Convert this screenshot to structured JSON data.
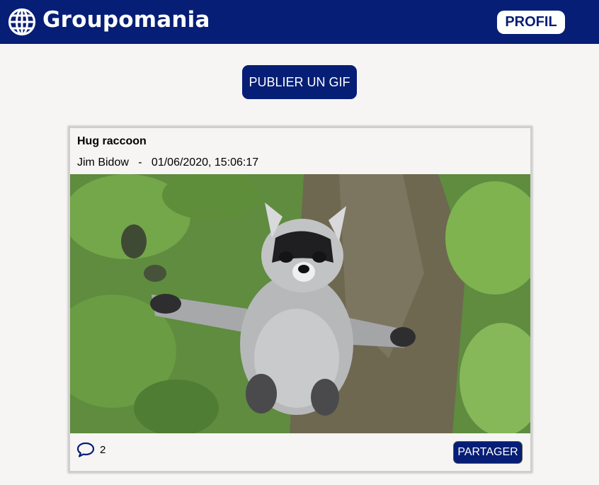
{
  "header": {
    "brand": "Groupomania",
    "logo_icon": "globe-icon",
    "profile_button": "PROFIL",
    "background": "#061e75"
  },
  "actions": {
    "publish_button": "PUBLIER UN GIF"
  },
  "post": {
    "title": "Hug raccoon",
    "author": "Jim Bidow",
    "separator": "-",
    "date": "01/06/2020, 15:06:17",
    "image_subject": "raccoon-gif",
    "comment_icon": "speech-bubble-icon",
    "comment_count": "2",
    "share_button": "PARTAGER"
  },
  "colors": {
    "brand_navy": "#061e75",
    "page_background": "#f6f5f4"
  }
}
